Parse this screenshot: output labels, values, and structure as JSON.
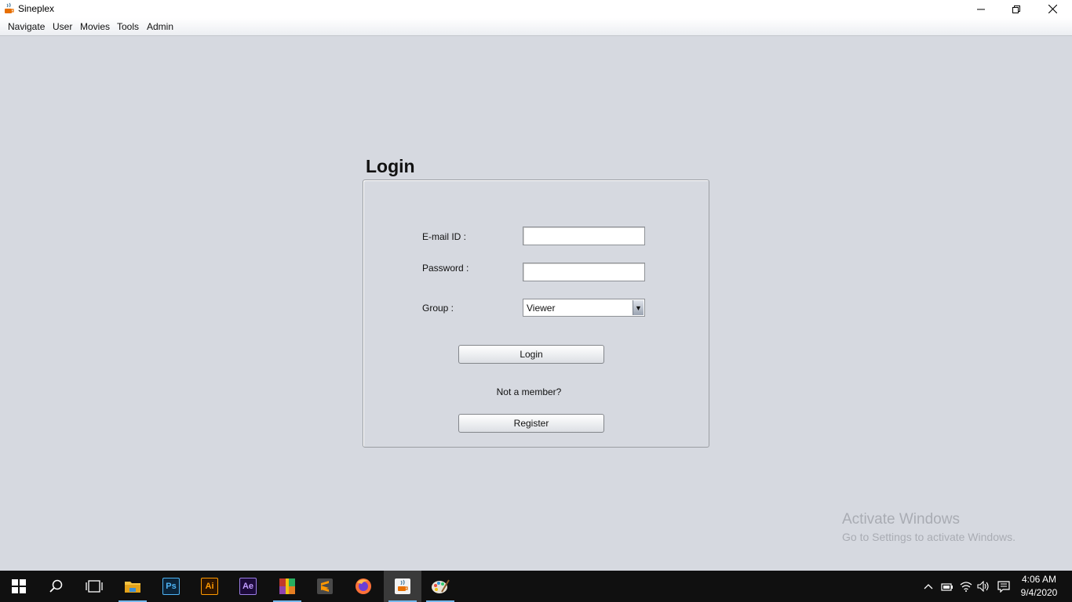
{
  "window": {
    "title": "Sineplex"
  },
  "menu": {
    "navigate": "Navigate",
    "user": "User",
    "movies": "Movies",
    "tools": "Tools",
    "admin": "Admin"
  },
  "login": {
    "heading": "Login",
    "email_label": "E-mail ID :",
    "email_value": "",
    "password_label": "Password :",
    "password_value": "",
    "group_label": "Group :",
    "group_value": "Viewer",
    "login_button": "Login",
    "not_member": "Not a member?",
    "register_button": "Register"
  },
  "watermark": {
    "title": "Activate Windows",
    "subtitle": "Go to Settings to activate Windows."
  },
  "taskbar": {
    "apps": [
      "start-icon",
      "search-icon",
      "task-view-icon",
      "file-explorer-icon",
      "photoshop-icon",
      "illustrator-icon",
      "after-effects-icon",
      "winrar-icon",
      "sublime-text-icon",
      "firefox-icon",
      "java-icon",
      "paint-icon"
    ],
    "photoshop": "Ps",
    "illustrator": "Ai",
    "after_effects": "Ae",
    "clock_time": "4:06 AM",
    "clock_date": "9/4/2020"
  },
  "colors": {
    "background": "#d6d9e0",
    "taskbar": "#101010",
    "accent": "#76b9ed"
  }
}
